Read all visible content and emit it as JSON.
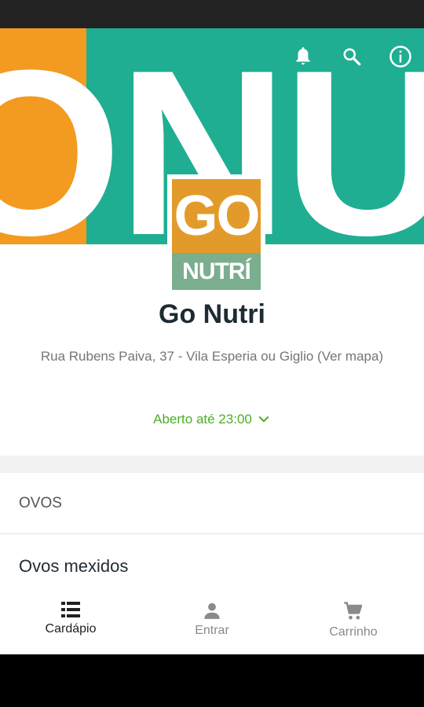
{
  "colors": {
    "hero_orange": "#f39a21",
    "hero_teal": "#1fae91",
    "logo_top": "#e29b2b",
    "logo_bottom": "#7aae8e",
    "accent_green": "#4cae24",
    "nav_active": "#212121",
    "nav_inactive": "#8a8a8a"
  },
  "header": {
    "icons": [
      "bell-icon",
      "search-icon",
      "info-icon"
    ]
  },
  "hero": {
    "bg_text_left": "O",
    "bg_text_right": "NUTR"
  },
  "logo": {
    "top_text": "GO",
    "bottom_text": "NUTRÍ"
  },
  "store": {
    "name": "Go Nutri",
    "address": "Rua Rubens Paiva, 37  - Vila Esperia ou Giglio (Ver mapa)",
    "hours": "Aberto até 23:00"
  },
  "menu": {
    "category": "OVOS",
    "first_item": "Ovos mexidos"
  },
  "bottom_nav": [
    {
      "label": "Cardápio",
      "icon": "list-icon",
      "active": true
    },
    {
      "label": "Entrar",
      "icon": "person-icon",
      "active": false
    },
    {
      "label": "Carrinho",
      "icon": "cart-icon",
      "active": false
    }
  ]
}
